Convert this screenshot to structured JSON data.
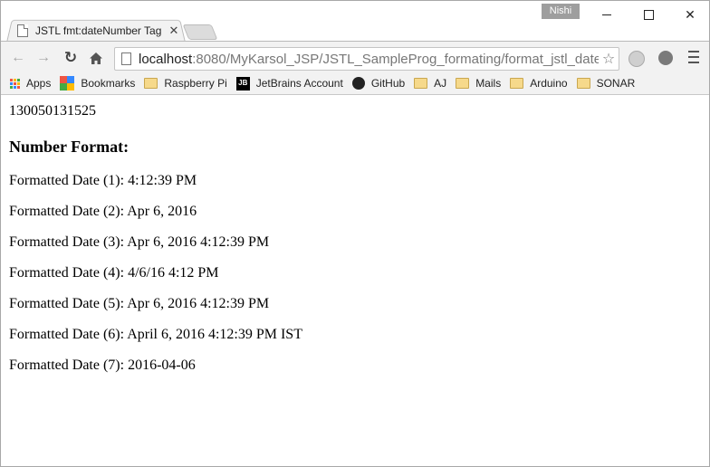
{
  "browser": {
    "tab_title": "JSTL fmt:dateNumber Tag",
    "user_name": "Nishi",
    "url_host": "localhost",
    "url_path": ":8080/MyKarsol_JSP/JSTL_SampleProg_formating/format_jstl_date",
    "bookmarks": [
      "Apps",
      "Bookmarks",
      "Raspberry Pi",
      "JetBrains Account",
      "GitHub",
      "AJ",
      "Mails",
      "Arduino",
      "SONAR"
    ]
  },
  "page": {
    "timestamp": "130050131525",
    "heading": "Number Format:",
    "lines": [
      "Formatted Date (1): 4:12:39 PM",
      "Formatted Date (2): Apr 6, 2016",
      "Formatted Date (3): Apr 6, 2016 4:12:39 PM",
      "Formatted Date (4): 4/6/16 4:12 PM",
      "Formatted Date (5): Apr 6, 2016 4:12:39 PM",
      "Formatted Date (6): April 6, 2016 4:12:39 PM IST",
      "Formatted Date (7): 2016-04-06"
    ]
  }
}
